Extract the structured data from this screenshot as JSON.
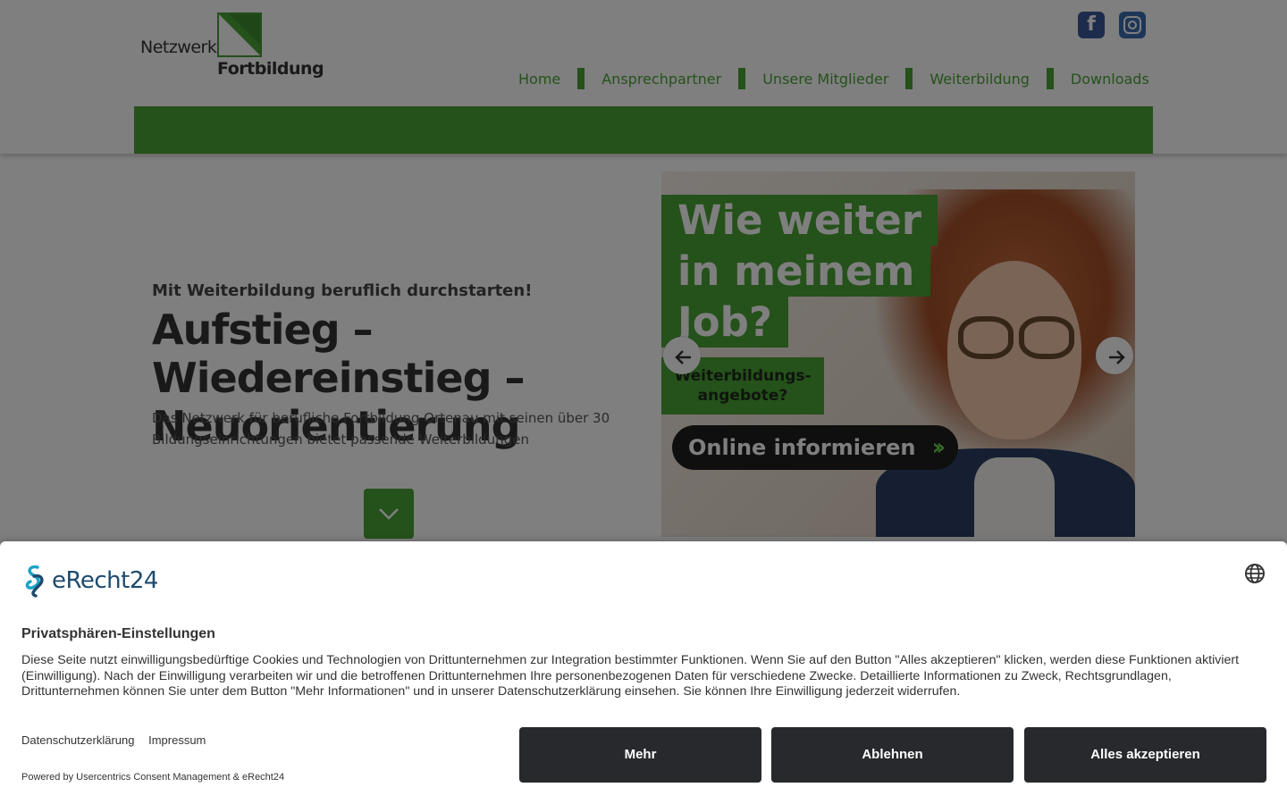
{
  "header": {
    "logo_word1": "Netzwerk",
    "logo_word2": "Fortbildung",
    "social": [
      {
        "name": "facebook-icon",
        "glyph": "f"
      },
      {
        "name": "instagram-icon"
      }
    ],
    "nav": [
      "Home",
      "Ansprechpartner",
      "Unsere Mitglieder",
      "Weiterbildung",
      "Downloads"
    ]
  },
  "hero": {
    "subtitle": "Mit Weiterbildung beruflich durchstarten!",
    "title": "Aufstieg – Wiedereinstieg – Neuorientierung",
    "description": "Das Netzwerk für berufliche Fortbildung Ortenau mit seinen über 30 Bildungseinrichtungen bietet passende Weiterbildungen",
    "banner": {
      "headline_lines": [
        "Wie weiter",
        "in meinem",
        "Job?"
      ],
      "sub_line1": "Weiterbildungs-",
      "sub_line2": "angebote?",
      "cta": "Online informieren",
      "cta_arrows": "››"
    }
  },
  "consent": {
    "logo_text": "eRecht24",
    "title": "Privatsphären-Einstellungen",
    "text": "Diese Seite nutzt einwilligungsbedürftige Cookies und Technologien von Drittunternehmen zur Integration bestimmter Funktionen. Wenn Sie auf den Button \"Alles akzeptieren\" klicken, werden diese Funktionen aktiviert (Einwilligung). Nach der Einwilligung verarbeiten wir und die betroffenen Drittunternehmen Ihre personenbezogenen Daten für verschiedene Zwecke. Detaillierte Informationen zu Zweck, Rechtsgrundlagen, Drittunternehmen können Sie unter dem Button \"Mehr Informationen\" und in unserer Datenschutzerklärung einsehen. Sie können Ihre Einwilligung jederzeit widerrufen.",
    "link_privacy": "Datenschutzerklärung",
    "link_imprint": "Impressum",
    "powered": "Powered by Usercentrics Consent Management & eRecht24",
    "buttons": {
      "more": "Mehr",
      "deny": "Ablehnen",
      "accept": "Alles akzeptieren"
    }
  },
  "colors": {
    "brand_green": "#4aa336",
    "button_dark": "#27292d",
    "logo_blue": "#1d4a6e"
  }
}
